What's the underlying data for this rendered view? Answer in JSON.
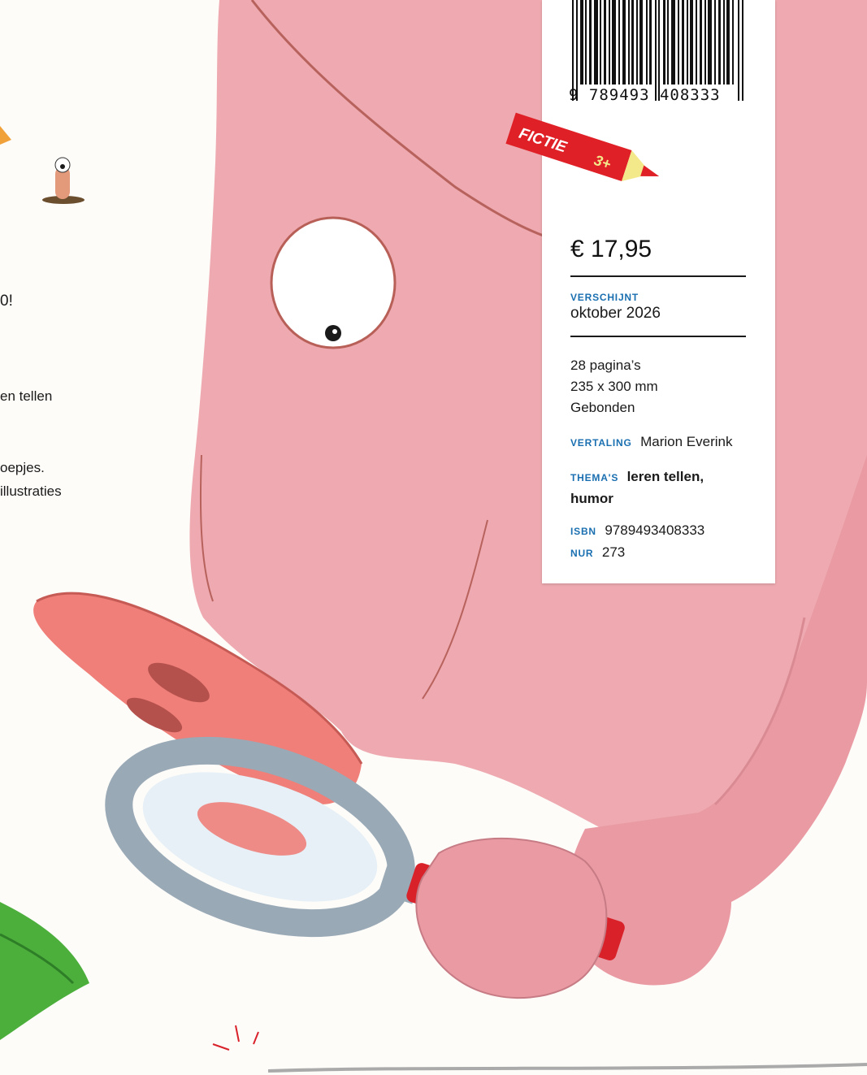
{
  "barcode": {
    "digits": "9 789493 408333",
    "icon": "barcode-icon"
  },
  "tag": {
    "label": "FICTIE",
    "age": "3+",
    "color": "#e02027",
    "tip_color": "#f3e98a"
  },
  "price": "€ 17,95",
  "release": {
    "label": "VERSCHIJNT",
    "value": "oktober 2026"
  },
  "specs": [
    "28 pagina’s",
    "235 x 300 mm",
    "Gebonden"
  ],
  "translation": {
    "label": "VERTALING",
    "value": "Marion Everink"
  },
  "themes": {
    "label": "THEMA'S",
    "value_line1": "leren tellen,",
    "value_line2": "humor"
  },
  "isbn": {
    "label": "ISBN",
    "value": "9789493408333"
  },
  "nur": {
    "label": "NUR",
    "value": "273"
  },
  "left_snippets": {
    "line1": "0!",
    "line2": "en tellen",
    "line3": "oepjes.",
    "line4": "illustraties"
  },
  "colors": {
    "label_blue": "#1a6fb0",
    "pig_pink": "#eeaab0",
    "snout": "#ef7f78",
    "red_handle": "#d9212a"
  }
}
